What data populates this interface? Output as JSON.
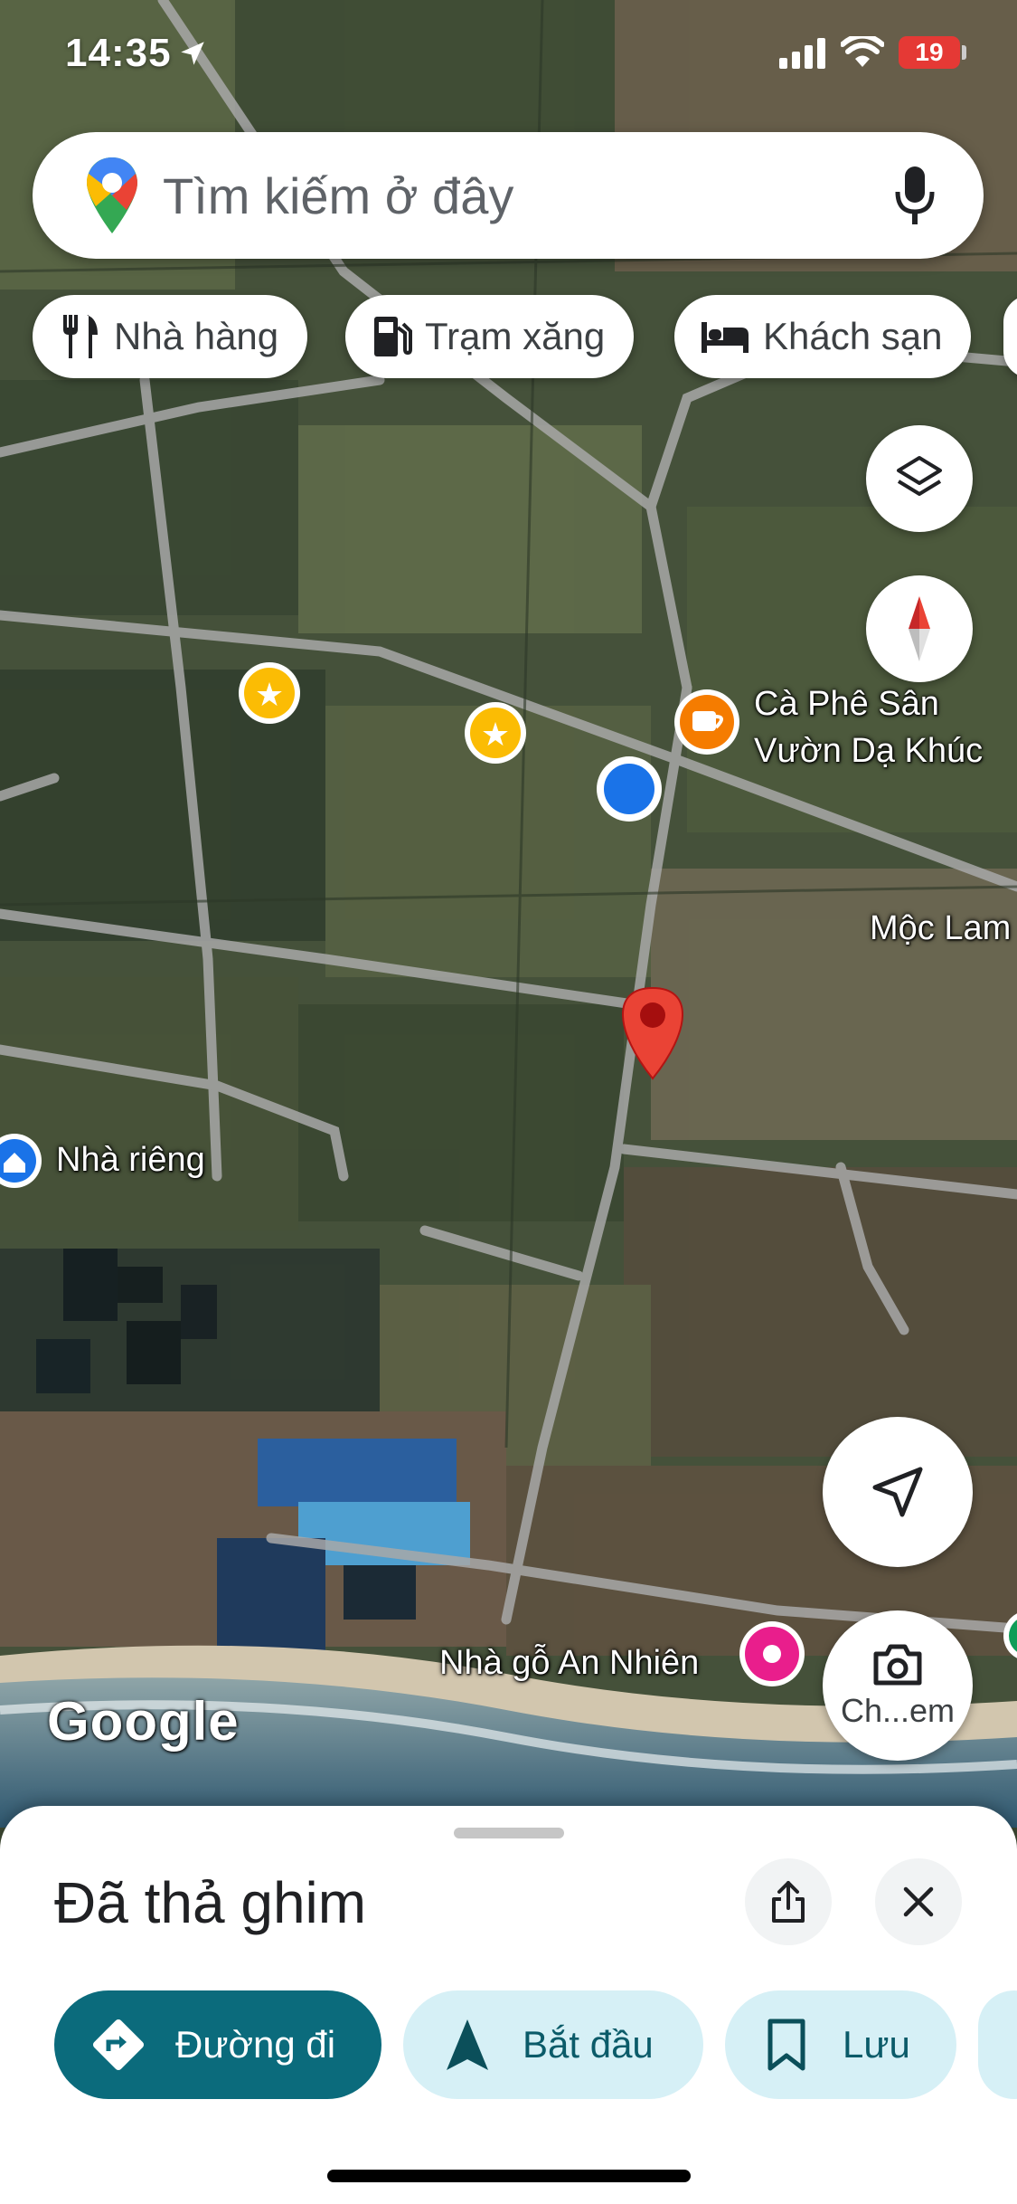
{
  "status_bar": {
    "time": "14:35",
    "battery": "19"
  },
  "search": {
    "placeholder": "Tìm kiếm ở đây",
    "icons": [
      "google-maps-pin-logo",
      "microphone-icon"
    ]
  },
  "category_chips": [
    {
      "label": "Nhà hàng",
      "icon": "fork-knife-icon"
    },
    {
      "label": "Trạm xăng",
      "icon": "gas-pump-icon"
    },
    {
      "label": "Khách sạn",
      "icon": "bed-icon"
    }
  ],
  "map": {
    "labels": {
      "cafe": [
        "Cà Phê Sân",
        "Vườn Dạ Khúc"
      ],
      "moc_lam": "Mộc Lam",
      "home": "Nhà riêng",
      "nha_go": "Nhà gỗ An Nhiên"
    },
    "google_logo": "Google",
    "controls": {
      "layers_icon": "layers-icon",
      "compass_icon": "compass-icon",
      "location_icon": "navigation-arrow-icon",
      "camera_label": "Ch...em"
    },
    "colors": {
      "pin": "#ea4335",
      "user_location": "#1a73e8",
      "cafe_marker": "#f57c00",
      "star_marker": "#fbbc04",
      "pink_marker": "#e91e8c"
    }
  },
  "sheet": {
    "title": "Đã thả ghim",
    "actions": [
      {
        "label": "Đường đi",
        "icon": "directions-icon"
      },
      {
        "label": "Bắt đầu",
        "icon": "navigation-icon"
      },
      {
        "label": "Lưu",
        "icon": "bookmark-icon"
      }
    ],
    "accent": "#0b6b7c"
  }
}
